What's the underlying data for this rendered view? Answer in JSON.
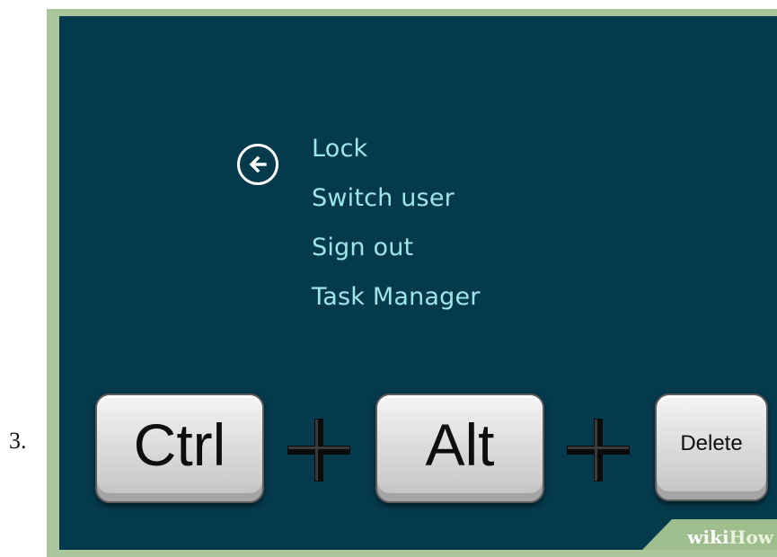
{
  "step": {
    "number": "3."
  },
  "security_menu": {
    "back_icon": "arrow-left-circle-icon",
    "items": [
      {
        "label": "Lock"
      },
      {
        "label": "Switch user"
      },
      {
        "label": "Sign out"
      },
      {
        "label": "Task Manager"
      }
    ]
  },
  "keyboard_shortcut": {
    "keys": [
      "Ctrl",
      "Alt",
      "Delete"
    ],
    "separator_icon": "plus-icon"
  },
  "watermark": {
    "part1": "wiki",
    "part2": "How"
  },
  "colors": {
    "screen_background": "#053a4c",
    "menu_text": "#9fe6ea",
    "frame": "#a9c79a"
  }
}
